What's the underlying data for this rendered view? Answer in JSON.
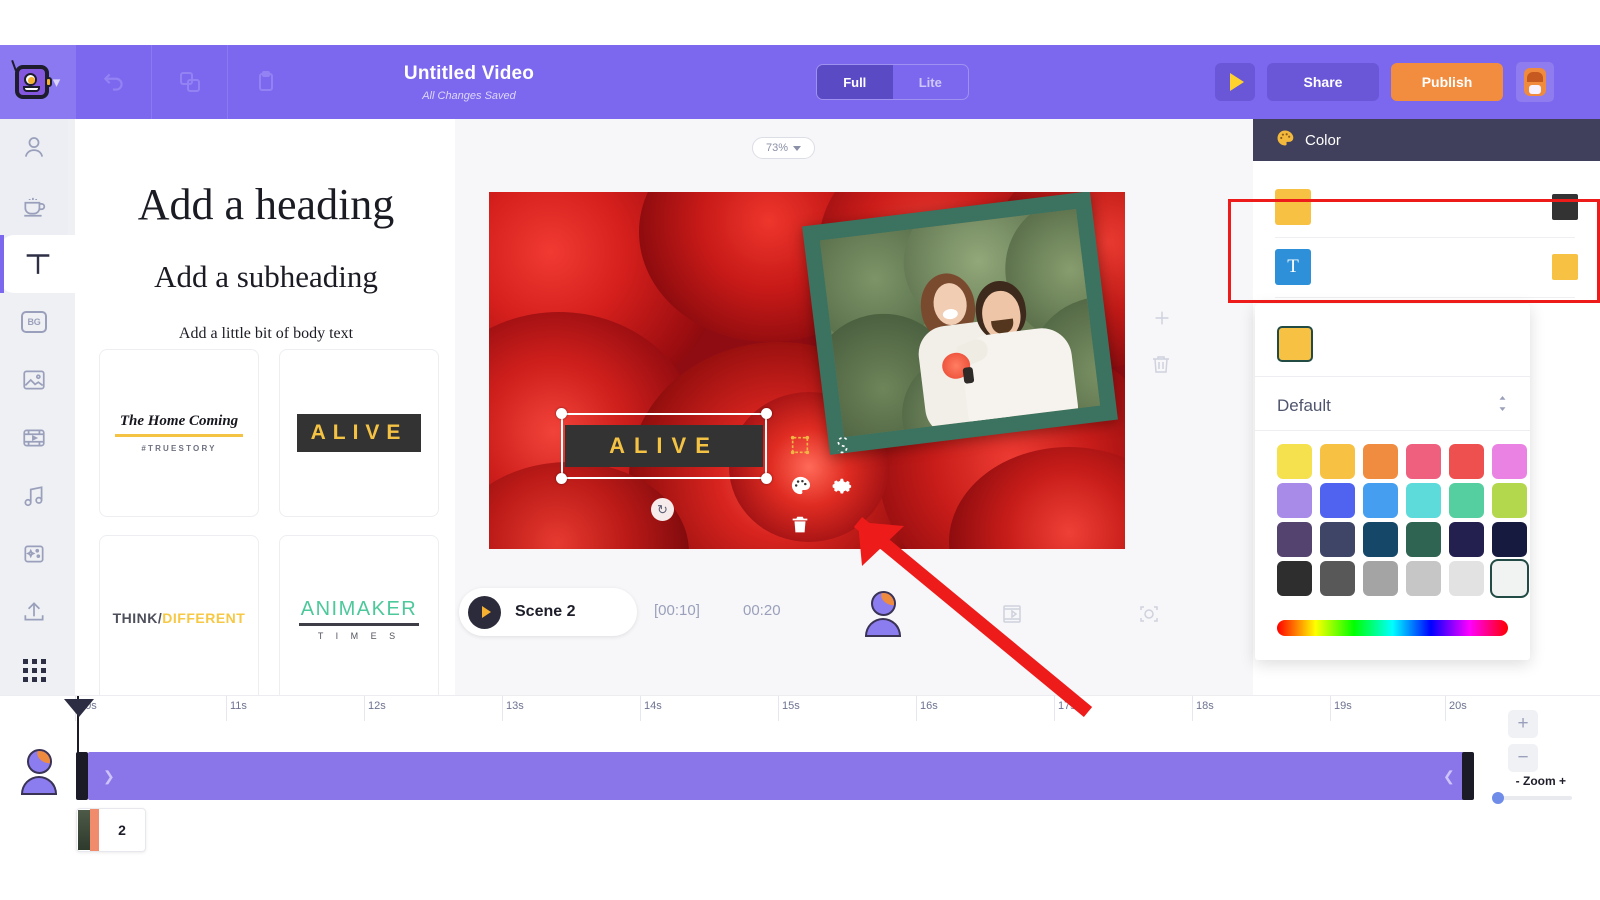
{
  "app": {
    "brand_logo": "animaker-logo",
    "title": "Untitled Video",
    "save_status": "All Changes Saved"
  },
  "topbar": {
    "undo_icon": "undo-icon",
    "redo_icon": "redo-icon",
    "copy_icon": "copy-icon",
    "paste_icon": "paste-icon",
    "mode_toggle": {
      "options": [
        "Full",
        "Lite"
      ],
      "selected": "Full"
    },
    "preview_label": "play-icon",
    "share_label": "Share",
    "publish_label": "Publish",
    "avatar_label": "user-avatar"
  },
  "sidebar": {
    "items": [
      {
        "name": "character",
        "icon": "character-icon",
        "active": false
      },
      {
        "name": "prop",
        "icon": "coffee-cup-icon",
        "active": false
      },
      {
        "name": "text",
        "icon": "text-T-icon",
        "active": true
      },
      {
        "name": "background",
        "icon": "bg-icon",
        "label": "BG",
        "active": false
      },
      {
        "name": "image",
        "icon": "image-icon",
        "active": false
      },
      {
        "name": "video",
        "icon": "film-icon",
        "active": false
      },
      {
        "name": "music",
        "icon": "music-note-icon",
        "active": false
      },
      {
        "name": "effects",
        "icon": "sparkle-icon",
        "active": false
      },
      {
        "name": "upload",
        "icon": "upload-icon",
        "active": false
      },
      {
        "name": "more",
        "icon": "grid-dots-icon",
        "active": false
      }
    ]
  },
  "text_panel": {
    "heading": "Add a heading",
    "subheading": "Add a subheading",
    "body": "Add a little bit of body text",
    "templates": [
      {
        "id": "home-coming",
        "title": "The Home Coming",
        "sub": "#TRUESTORY"
      },
      {
        "id": "alive",
        "title": "ALIVE"
      },
      {
        "id": "think-different",
        "part1": "THINK/",
        "part2": "DIFFERENT"
      },
      {
        "id": "animaker-times",
        "title": "ANIMAKER",
        "sub": "T I M E S"
      }
    ],
    "collapse_icon": "chevron-left-icon"
  },
  "stage": {
    "zoom_value": "73%",
    "zoom_caret": "chevron-down-icon",
    "add_icon": "plus-icon",
    "delete_icon": "trash-icon",
    "selected_text": "ALIVE",
    "rotate_icon": "rotate-icon",
    "object_tools": [
      {
        "name": "crop-icon"
      },
      {
        "name": "shape-path-icon"
      },
      {
        "name": "color-palette-icon"
      },
      {
        "name": "settings-gear-icon"
      },
      {
        "name": "delete-trash-icon"
      }
    ]
  },
  "scene_bar": {
    "play_icon": "play-icon",
    "scene_name": "Scene 2",
    "current_time": "[00:10]",
    "total_time": "00:20",
    "character_icon": "character-icon",
    "transition_icon": "transition-icon",
    "camera_icon": "camera-focus-icon"
  },
  "timeline": {
    "ticks": [
      "10s",
      "11s",
      "12s",
      "13s",
      "14s",
      "15s",
      "16s",
      "17s",
      "18s",
      "19s",
      "20s"
    ],
    "track_icon": "character-track-icon",
    "track_expand_icon": "chevron-right-icon",
    "track_collapse_icon": "chevron-left-icon",
    "scene_thumb_number": "2",
    "zoom_in": "+",
    "zoom_out": "−",
    "zoom_label": "- Zoom +"
  },
  "color_popup": {
    "header_title": "Color",
    "header_icon": "palette-icon",
    "rows": [
      {
        "name": "fill-row",
        "lead_color": "#f7c244",
        "trail_color": "#333333"
      },
      {
        "name": "text-row",
        "lead_icon": "text-T-icon",
        "trail_color": "#f7c244"
      }
    ],
    "current_color": "#f7c244",
    "preset_label": "Default",
    "preset_caret": "sort-updown-icon",
    "swatches": [
      "#f5e04e",
      "#f7c244",
      "#f08c3f",
      "#ef5f7e",
      "#ee5050",
      "#ea82e4",
      "#a88ae8",
      "#4f63f0",
      "#459ef0",
      "#5ddbdb",
      "#55cf9f",
      "#b4d84d",
      "#55436f",
      "#3f4566",
      "#154769",
      "#2f6352",
      "#231f4f",
      "#171a3f",
      "#2e2e2e",
      "#585858",
      "#a4a4a4",
      "#c6c6c6",
      "#e2e2e2",
      "#f1f3f2"
    ],
    "selected_swatch_index": 23,
    "spectrum": "hue-spectrum-slider"
  },
  "annotations": {
    "highlight_box_color": "#ee1b1b",
    "arrow_color": "#ee1b1b"
  }
}
